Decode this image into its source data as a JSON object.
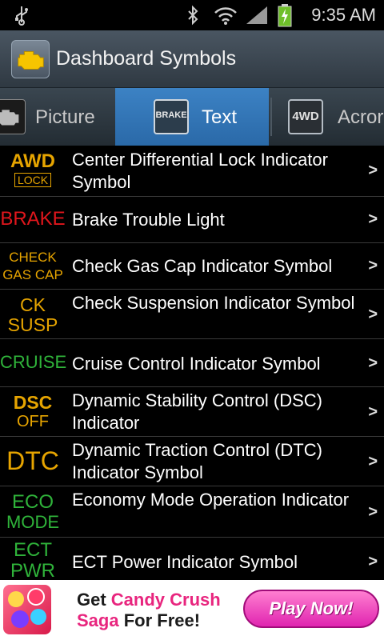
{
  "status_bar": {
    "time": "9:35 AM",
    "icons": [
      "usb-icon",
      "bluetooth-icon",
      "wifi-icon",
      "signal-icon",
      "battery-charging-icon"
    ]
  },
  "title_bar": {
    "title": "Dashboard Symbols",
    "icon": "engine-check-icon"
  },
  "tabs": [
    {
      "label": "Picture",
      "icon": "engine-picture-icon",
      "selected": false
    },
    {
      "label": "Text",
      "icon": "brake-text-icon",
      "icon_text": "BRAKE",
      "selected": true
    },
    {
      "label": "Acronym",
      "visible_label": "Acror",
      "icon": "4wd-text-icon",
      "icon_text": "4WD",
      "selected": false
    }
  ],
  "list": {
    "items": [
      {
        "symbol_lines": [
          "AWD",
          "LOCK"
        ],
        "symbol_color": "#e6a400",
        "label": "Center Differential Lock Indicator Symbol"
      },
      {
        "symbol_lines": [
          "BRAKE"
        ],
        "symbol_color": "#e0161c",
        "label": "Brake Trouble Light"
      },
      {
        "symbol_lines": [
          "CHECK",
          "GAS CAP"
        ],
        "symbol_color": "#e6a400",
        "label": "Check Gas Cap Indicator Symbol"
      },
      {
        "symbol_lines": [
          "CK",
          "SUSP"
        ],
        "symbol_color": "#e6a400",
        "label": "Check Suspension Indicator Symbol"
      },
      {
        "symbol_lines": [
          "CRUISE"
        ],
        "symbol_color": "#2fb33a",
        "label": "Cruise Control Indicator Symbol"
      },
      {
        "symbol_lines": [
          "DSC",
          "OFF"
        ],
        "symbol_color": "#e6a400",
        "label": "Dynamic Stability Control (DSC) Indicator"
      },
      {
        "symbol_lines": [
          "DTC"
        ],
        "symbol_color": "#e6a400",
        "label": "Dynamic Traction Control (DTC) Indicator Symbol"
      },
      {
        "symbol_lines": [
          "ECO",
          "MODE"
        ],
        "symbol_color": "#2fb33a",
        "label": "Economy Mode Operation Indicator"
      },
      {
        "symbol_lines": [
          "ECT",
          "PWR"
        ],
        "symbol_color": "#2fb33a",
        "label": "ECT Power Indicator Symbol"
      }
    ],
    "chevron": ">"
  },
  "ad": {
    "prefix": "Get ",
    "highlight": "Candy Crush",
    "line2_highlight": "Saga",
    "line2_rest": " For Free!",
    "button": "Play Now!",
    "colors": {
      "highlight": "#e8257e",
      "button": "#e025b0"
    }
  }
}
